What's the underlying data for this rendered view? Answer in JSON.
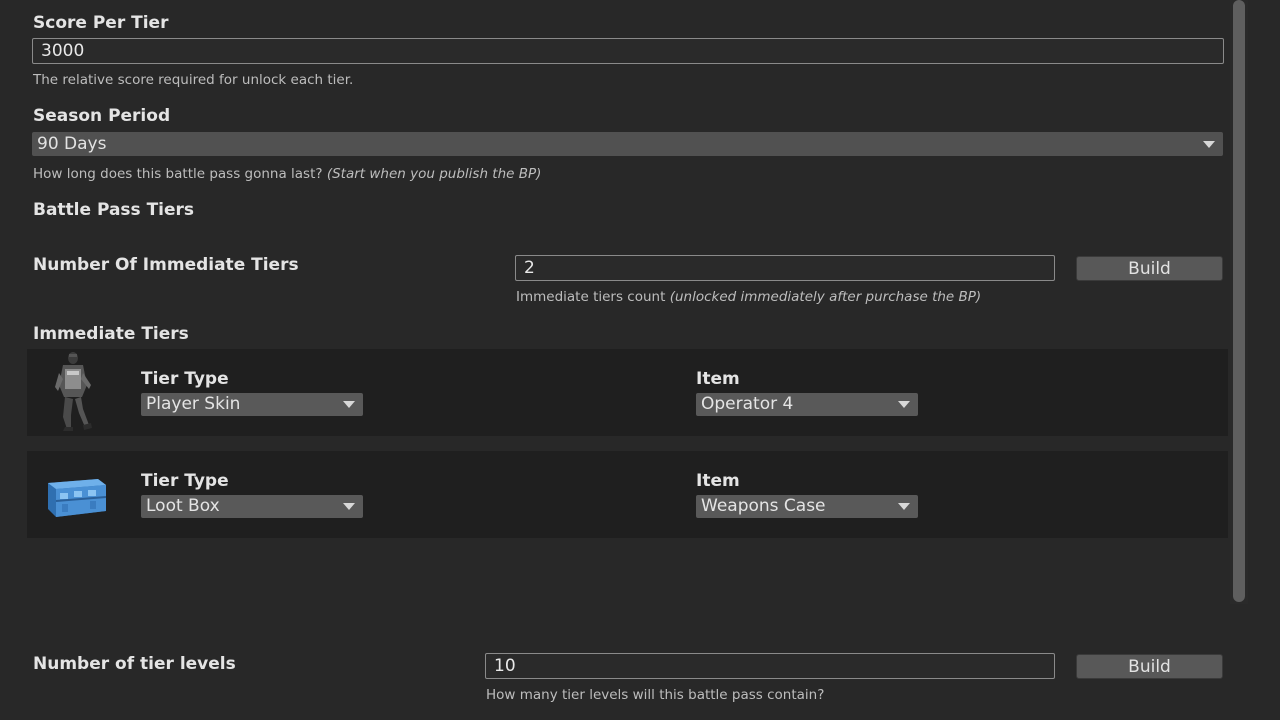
{
  "score_per_tier": {
    "label": "Score Per Tier",
    "value": "3000",
    "help": "The relative score required for unlock each tier."
  },
  "season_period": {
    "label": "Season Period",
    "selected": "90 Days",
    "help_main": "How long does this battle pass gonna last? ",
    "help_italic": "(Start when you publish the BP)"
  },
  "battle_pass_tiers": {
    "heading": "Battle Pass Tiers"
  },
  "immediate_count": {
    "label": "Number Of Immediate Tiers",
    "value": "2",
    "button": "Build",
    "help_main": "Immediate tiers count ",
    "help_italic": "(unlocked immediately after purchase the BP)"
  },
  "immediate_tiers": {
    "heading": "Immediate Tiers",
    "rows": [
      {
        "icon": "player-skin-operator-icon",
        "tier_type_label": "Tier Type",
        "tier_type_value": "Player Skin",
        "item_label": "Item",
        "item_value": "Operator 4"
      },
      {
        "icon": "loot-box-case-icon",
        "tier_type_label": "Tier Type",
        "tier_type_value": "Loot Box",
        "item_label": "Item",
        "item_value": "Weapons Case"
      }
    ]
  },
  "tier_levels": {
    "label": "Number of tier levels",
    "value": "10",
    "button": "Build",
    "help": "How many tier levels will this battle pass contain?"
  },
  "colors": {
    "background": "#282828",
    "row_background": "#1f1f1f",
    "field_background": "#2a2a2a",
    "dropdown_background": "#515151",
    "button_background": "#585858",
    "text": "#e4e4e4"
  }
}
